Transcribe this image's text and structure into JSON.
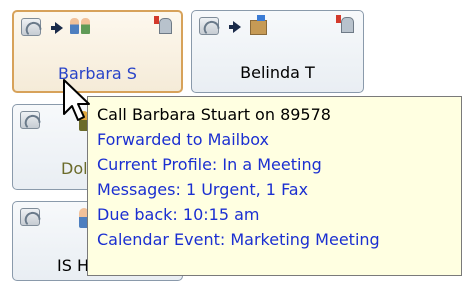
{
  "colors": {
    "selected_border": "#d7a25a",
    "link_text": "#1b2fd1",
    "tooltip_bg": "#ffffe1"
  },
  "contacts": [
    {
      "name": "Barbara S",
      "status_icon": "people-icon",
      "mail_icon": "mailbox-icon"
    },
    {
      "name": "Belinda T",
      "status_icon": "building-icon",
      "mail_icon": "mailbox-icon"
    },
    {
      "name": "Dol",
      "status_icon": "person-icon"
    },
    {
      "name": "IS H",
      "status_icon": "person-icon"
    }
  ],
  "tooltip": {
    "call_line": "Call Barbara Stuart on 89578",
    "forwarded": "Forwarded to Mailbox",
    "profile": "Current Profile: In a Meeting",
    "messages": "Messages: 1 Urgent, 1 Fax",
    "due_back": "Due back: 10:15 am",
    "calendar": "Calendar Event: Marketing Meeting"
  }
}
